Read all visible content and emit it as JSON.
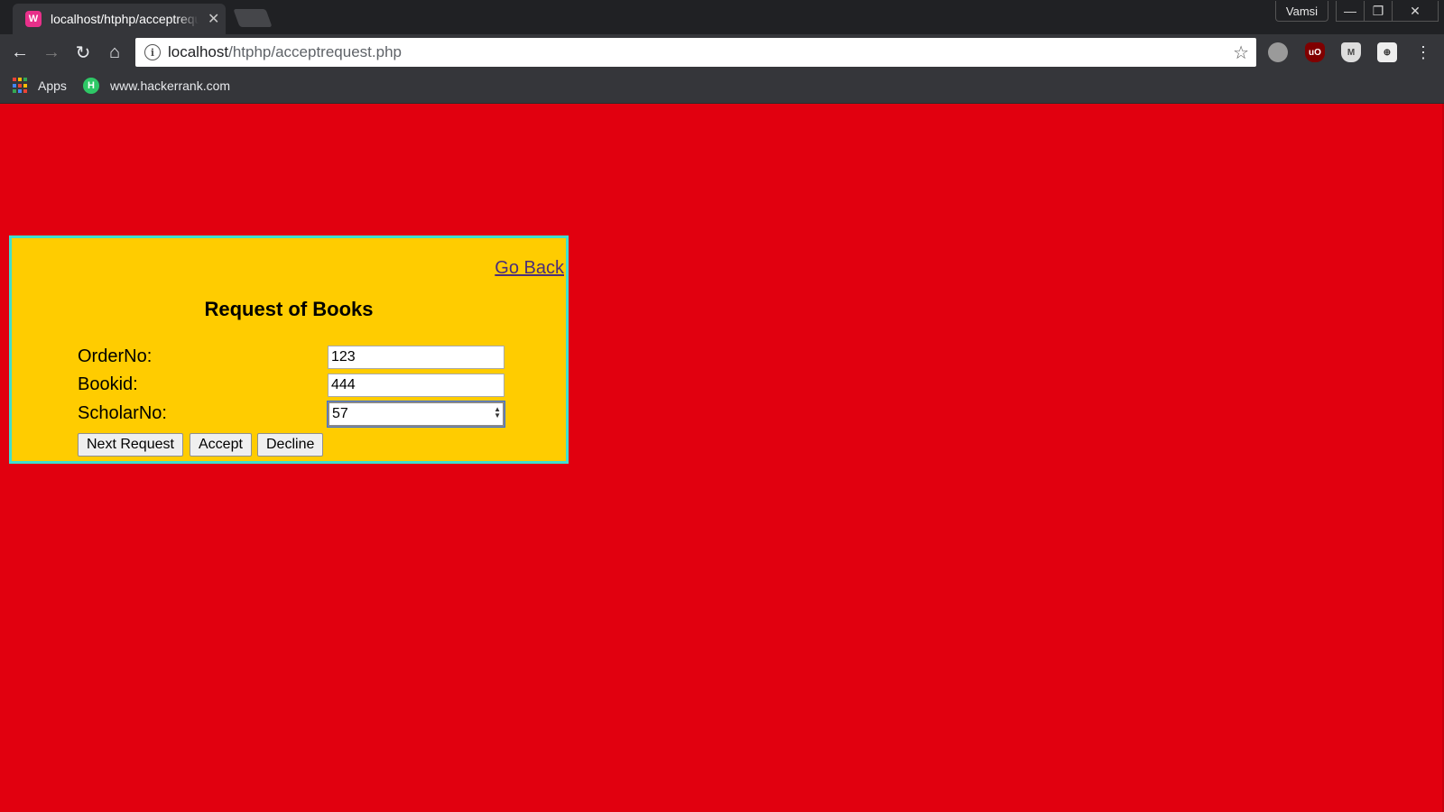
{
  "browser": {
    "tab_title": "localhost/htphp/acceptrequest.php",
    "tab_favicon_text": "W",
    "profile_name": "Vamsi",
    "url_host": "localhost",
    "url_path": "/htphp/acceptrequest.php",
    "bookmarks": [
      {
        "label": "Apps",
        "icon": "apps-grid-icon"
      },
      {
        "label": "www.hackerrank.com",
        "icon": "hackerrank-icon"
      }
    ],
    "extensions": [
      "cloud-icon",
      "ublock-icon",
      "shield-icon",
      "extension-icon"
    ],
    "colors": {
      "chrome": "#35363a",
      "titlebar": "#202124"
    }
  },
  "page": {
    "background": "#e1000f",
    "card_background": "#ffcc00",
    "card_border": "#3fe0d0",
    "go_back_label": "Go Back",
    "title": "Request of Books",
    "fields": {
      "order_no": {
        "label": "OrderNo:",
        "value": "123"
      },
      "book_id": {
        "label": "Bookid:",
        "value": "444"
      },
      "scholar_no": {
        "label": "ScholarNo:",
        "value": "57"
      }
    },
    "buttons": {
      "next": "Next Request",
      "accept": "Accept",
      "decline": "Decline"
    }
  }
}
